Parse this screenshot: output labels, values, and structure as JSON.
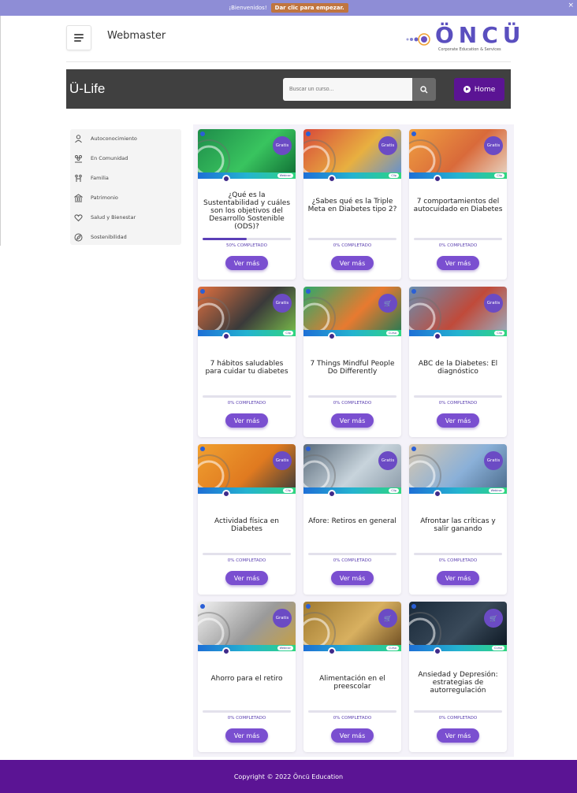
{
  "topbar": {
    "greeting": "¡Bienvenidos!",
    "cta": "Dar clic para empezar.",
    "close": "×"
  },
  "header": {
    "site_title": "Webmaster",
    "logo_text": "ÖNCÜ",
    "logo_tagline": "Corporate Education & Services"
  },
  "hero": {
    "title": "Ü-Life",
    "search_placeholder": "Buscar un curso...",
    "home_label": "Home"
  },
  "sidebar": {
    "items": [
      {
        "label": "Autoconocimiento",
        "icon": "person-icon"
      },
      {
        "label": "En Comunidad",
        "icon": "community-icon"
      },
      {
        "label": "Familia",
        "icon": "family-icon"
      },
      {
        "label": "Patrimonio",
        "icon": "bank-icon"
      },
      {
        "label": "Salud y Bienestar",
        "icon": "heart-icon"
      },
      {
        "label": "Sostenibilidad",
        "icon": "leaf-icon"
      }
    ]
  },
  "courses": [
    {
      "title": "¿Qué es la Sustentabilidad y cuáles son los objetivos del Desarrollo Sostenible (ODS)?",
      "progress": 0.5,
      "progress_label": "50% COMPLETADO",
      "badge": "Gratis",
      "kind": "Webinar",
      "button": "Ver más",
      "colors": [
        "#1e8c4a",
        "#39c45f",
        "#0e6b33"
      ]
    },
    {
      "title": "¿Sabes qué es la Triple Meta en Diabetes tipo 2?",
      "progress": 0,
      "progress_label": "0% COMPLETADO",
      "badge": "Gratis",
      "kind": "Clip",
      "button": "Ver más",
      "colors": [
        "#d84a3a",
        "#e8b040",
        "#5b8fd9"
      ]
    },
    {
      "title": "7 comportamientos del autocuidado en Diabetes",
      "progress": 0,
      "progress_label": "0% COMPLETADO",
      "badge": "Gratis",
      "kind": "Clip",
      "button": "Ver más",
      "colors": [
        "#f0a040",
        "#d96a3a",
        "#e8d8c8"
      ]
    },
    {
      "title": "7 hábitos saludables para cuidar tu diabetes",
      "progress": 0,
      "progress_label": "0% COMPLETADO",
      "badge": "Gratis",
      "kind": "Clip",
      "button": "Ver más",
      "colors": [
        "#e07040",
        "#3a3a3a",
        "#7bc04a"
      ]
    },
    {
      "title": "7 Things Mindful People Do Differently",
      "progress": 0,
      "progress_label": "0% COMPLETADO",
      "badge": "cart",
      "kind": "Curso",
      "button": "Ver más",
      "colors": [
        "#2fa86a",
        "#e87a30",
        "#1e7a55"
      ]
    },
    {
      "title": "ABC de la Diabetes: El diagnóstico",
      "progress": 0,
      "progress_label": "0% COMPLETADO",
      "badge": "Gratis",
      "kind": "Clip",
      "button": "Ver más",
      "colors": [
        "#6a8fb0",
        "#c04a3a",
        "#9ab0c4"
      ]
    },
    {
      "title": "Actividad física en Diabetes",
      "progress": 0,
      "progress_label": "0% COMPLETADO",
      "badge": "Gratis",
      "kind": "Clip",
      "button": "Ver más",
      "colors": [
        "#f0a030",
        "#e07a20",
        "#3a3a3a"
      ]
    },
    {
      "title": "Afore: Retiros en general",
      "progress": 0,
      "progress_label": "0% COMPLETADO",
      "badge": "Gratis",
      "kind": "Clip",
      "button": "Ver más",
      "colors": [
        "#5a6a7a",
        "#c8d4dc",
        "#8a9aa8"
      ]
    },
    {
      "title": "Afrontar las críticas y salir ganando",
      "progress": 0,
      "progress_label": "0% COMPLETADO",
      "badge": "Gratis",
      "kind": "Webinar",
      "button": "Ver más",
      "colors": [
        "#d8c8b0",
        "#8ab0d8",
        "#4a6a8a"
      ]
    },
    {
      "title": "Ahorro para el retiro",
      "progress": 0,
      "progress_label": "0% COMPLETADO",
      "badge": "Gratis",
      "kind": "Webinar",
      "button": "Ver más",
      "colors": [
        "#f2f2f2",
        "#9a9a9a",
        "#c8a040"
      ]
    },
    {
      "title": "Alimentación en el preescolar",
      "progress": 0,
      "progress_label": "0% COMPLETADO",
      "badge": "cart",
      "kind": "Curso",
      "button": "Ver más",
      "colors": [
        "#a07a30",
        "#d8b060",
        "#6a4a20"
      ]
    },
    {
      "title": "Ansiedad y Depresión: estrategias de autorregulación",
      "progress": 0,
      "progress_label": "0% COMPLETADO",
      "badge": "cart",
      "kind": "Curso",
      "button": "Ver más",
      "colors": [
        "#1a2a3a",
        "#3a4a5a",
        "#0a1520"
      ]
    }
  ],
  "footer": {
    "copyright": "Copyright © 2022 Öncü Education"
  }
}
